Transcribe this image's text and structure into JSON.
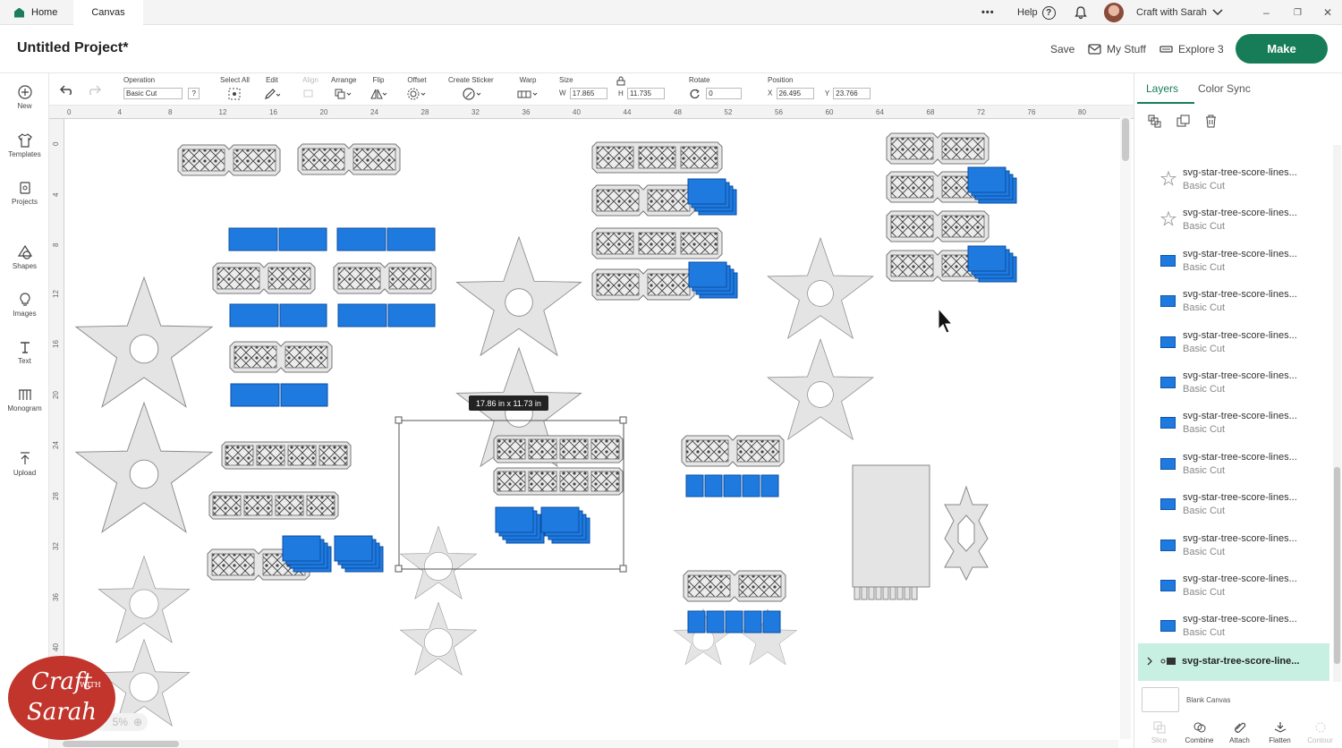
{
  "tabs": {
    "home": "Home",
    "canvas": "Canvas"
  },
  "topbar": {
    "help": "Help",
    "help_icon": "?",
    "user": "Craft with Sarah",
    "more": "•••"
  },
  "header": {
    "title": "Untitled Project*",
    "save": "Save",
    "my_stuff": "My Stuff",
    "machine": "Explore 3",
    "make": "Make"
  },
  "toolbar": {
    "operation_label": "Operation",
    "operation_value": "Basic Cut",
    "operation_help": "?",
    "select_all": "Select All",
    "edit": "Edit",
    "align": "Align",
    "arrange": "Arrange",
    "flip": "Flip",
    "offset": "Offset",
    "create_sticker": "Create Sticker",
    "warp": "Warp",
    "size": "Size",
    "w_label": "W",
    "w_value": "17.865",
    "h_label": "H",
    "h_value": "11.735",
    "rotate": "Rotate",
    "rotate_value": "0",
    "position": "Position",
    "x_label": "X",
    "x_value": "26.495",
    "y_label": "Y",
    "y_value": "23.766"
  },
  "leftbar": [
    "New",
    "Templates",
    "Projects",
    "Shapes",
    "Images",
    "Text",
    "Monogram",
    "Upload"
  ],
  "ruler": {
    "top": [
      "0",
      "4",
      "8",
      "12",
      "16",
      "20",
      "24",
      "28",
      "32",
      "36",
      "40",
      "44",
      "48",
      "52",
      "56",
      "60",
      "64",
      "68",
      "72",
      "76",
      "80"
    ],
    "left": [
      "0",
      "4",
      "8",
      "12",
      "16",
      "20",
      "24",
      "28",
      "32",
      "36",
      "40"
    ]
  },
  "canvas": {
    "size_badge": "17.86  in x 11.73  in"
  },
  "panel": {
    "tab_layers": "Layers",
    "tab_color_sync": "Color Sync",
    "layers": [
      {
        "name": "svg-star-tree-score-lines...",
        "op": "Basic Cut",
        "icon": "star-icon"
      },
      {
        "name": "svg-star-tree-score-lines...",
        "op": "Basic Cut",
        "icon": "star-icon"
      },
      {
        "name": "svg-star-tree-score-lines...",
        "op": "Basic Cut",
        "icon": "square-icon"
      },
      {
        "name": "svg-star-tree-score-lines...",
        "op": "Basic Cut",
        "icon": "square-icon"
      },
      {
        "name": "svg-star-tree-score-lines...",
        "op": "Basic Cut",
        "icon": "square-icon"
      },
      {
        "name": "svg-star-tree-score-lines...",
        "op": "Basic Cut",
        "icon": "square-icon"
      },
      {
        "name": "svg-star-tree-score-lines...",
        "op": "Basic Cut",
        "icon": "square-icon"
      },
      {
        "name": "svg-star-tree-score-lines...",
        "op": "Basic Cut",
        "icon": "square-icon"
      },
      {
        "name": "svg-star-tree-score-lines...",
        "op": "Basic Cut",
        "icon": "square-icon"
      },
      {
        "name": "svg-star-tree-score-lines...",
        "op": "Basic Cut",
        "icon": "square-icon"
      },
      {
        "name": "svg-star-tree-score-lines...",
        "op": "Basic Cut",
        "icon": "square-icon"
      },
      {
        "name": "svg-star-tree-score-lines...",
        "op": "Basic Cut",
        "icon": "square-icon"
      }
    ],
    "group_name": "svg-star-tree-score-line...",
    "blank_canvas": "Blank Canvas",
    "bottom": [
      "Slice",
      "Combine",
      "Attach",
      "Flatten",
      "Contour"
    ]
  },
  "brand": {
    "line1": "Craft",
    "with": "WITH",
    "line2": "Sarah"
  },
  "zoom": "5%",
  "colors": {
    "accent": "#177d58",
    "blue": "#1f7ae0",
    "shape_fill": "#e4e4e4"
  }
}
